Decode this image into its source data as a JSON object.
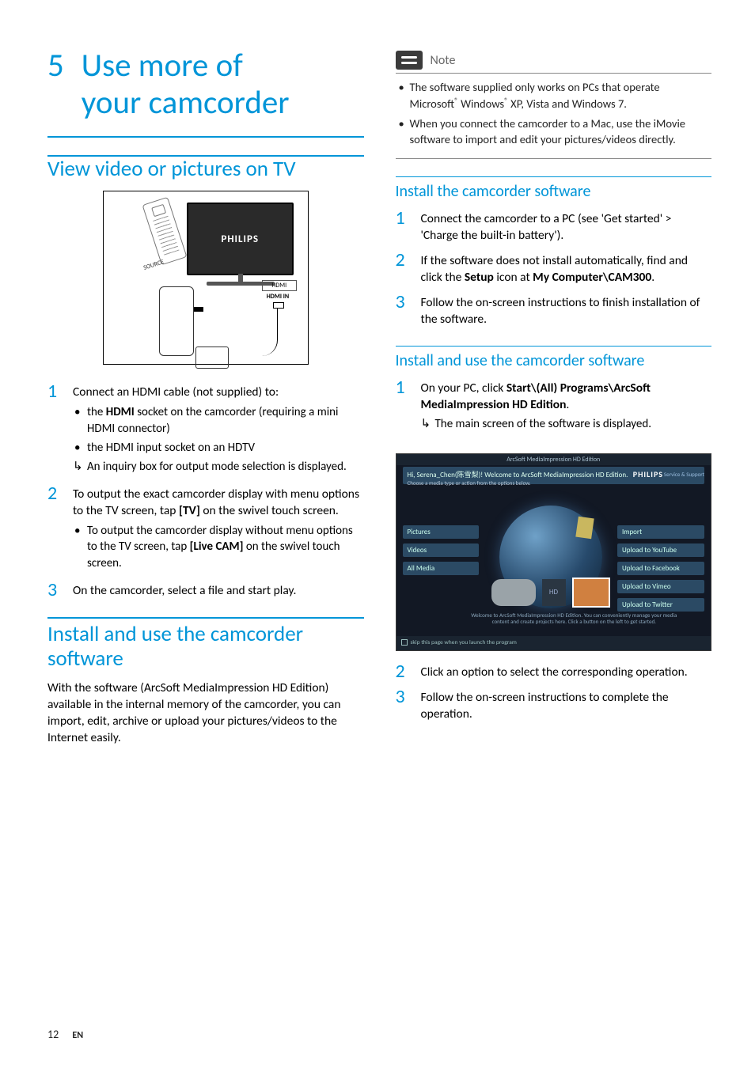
{
  "chapter": {
    "num": "5",
    "title_line1": "Use more of",
    "title_line2": "your camcorder"
  },
  "sectionA": {
    "title": "View video or pictures on TV",
    "diagram": {
      "tv_brand": "PHILIPS",
      "source_label": "SOURCE",
      "hdmi_label": "HDMI",
      "hdmi_in": "HDMI IN"
    },
    "steps": [
      {
        "num": "1",
        "text": "Connect an HDMI cable (not supplied) to:",
        "subs": [
          {
            "type": "bullet",
            "html": "the <b>HDMI</b> socket on the camcorder (requiring a mini HDMI connector)"
          },
          {
            "type": "bullet",
            "html": "the HDMI input socket on an HDTV"
          },
          {
            "type": "arrow",
            "html": "An inquiry box for output mode selection is displayed."
          }
        ]
      },
      {
        "num": "2",
        "text_html": "To output the exact camcorder display with menu options to the TV screen, tap <b>[TV]</b> on the swivel touch screen.",
        "subs": [
          {
            "type": "bullet",
            "html": "To output the camcorder display without menu options to the TV screen, tap <b>[Live CAM]</b> on the swivel touch screen."
          }
        ]
      },
      {
        "num": "3",
        "text": "On the camcorder, select a file and start play."
      }
    ]
  },
  "sectionB": {
    "title": "Install and use the camcorder software",
    "intro": "With the software (ArcSoft MediaImpression HD Edition) available in the internal memory of the camcorder, you can import, edit, archive or upload your pictures/videos to the Internet easily."
  },
  "note": {
    "label": "Note",
    "items": [
      "The software supplied only works on PCs that operate Microsoft<sup>®</sup> Windows<sup>®</sup> XP, Vista and Windows 7.",
      "When you connect the camcorder to a Mac, use the iMovie software to import and edit your pictures/videos directly."
    ]
  },
  "sectionC": {
    "title": "Install the camcorder software",
    "steps": [
      {
        "num": "1",
        "html": "Connect the camcorder to a PC (see 'Get started' > 'Charge the built-in battery')."
      },
      {
        "num": "2",
        "html": "If the software does not install automatically, find and click the <b>Setup</b> icon at <b>My Computer\\CAM300</b>."
      },
      {
        "num": "3",
        "html": "Follow the on-screen instructions to finish installation of the software."
      }
    ]
  },
  "sectionD": {
    "title": "Install and use the camcorder software",
    "steps_top": [
      {
        "num": "1",
        "html": "On your PC, click <b>Start\\(All) Programs\\ArcSoft MediaImpression HD Edition</b>.",
        "subs": [
          {
            "type": "arrow",
            "html": "The main screen of the software is displayed."
          }
        ]
      }
    ],
    "screenshot": {
      "titlebar": "ArcSoft MediaImpression HD Edition",
      "greeting": "Hi, Serena_Chen(陈雪梨)! Welcome to ArcSoft MediaImpression HD Edition.",
      "greeting_sub": "Choose a media type or action from the options below.",
      "brand": "PHILIPS",
      "support": "Service & Support",
      "left_buttons": [
        "Pictures",
        "Videos",
        "All Media"
      ],
      "right_buttons": [
        "Import",
        "Upload to YouTube",
        "Upload to Facebook",
        "Upload to Vimeo",
        "Upload to Twitter"
      ],
      "hd": "HD",
      "footer_text": "Welcome to ArcSoft MediaImpression HD Edition. You can conveniently manage your media content and create projects here. Click a button on the left to get started.",
      "skip_checkbox": "skip this page when you launch the program"
    },
    "steps_bottom": [
      {
        "num": "2",
        "html": "Click an option to select the corresponding operation."
      },
      {
        "num": "3",
        "html": "Follow the on-screen instructions to complete the operation."
      }
    ]
  },
  "footer": {
    "page": "12",
    "lang": "EN"
  }
}
